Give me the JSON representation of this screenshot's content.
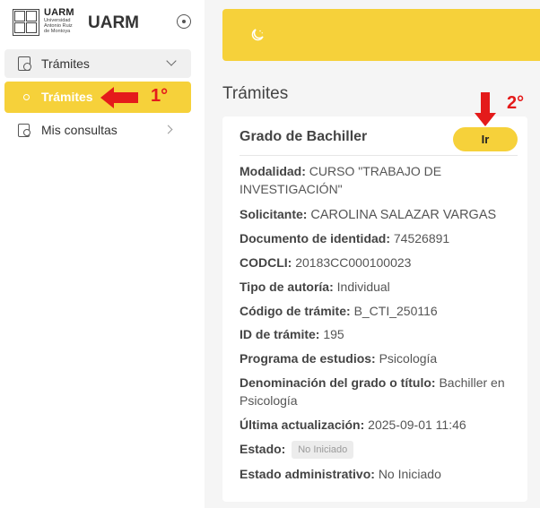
{
  "brand": {
    "short_name": "UARM",
    "institution_line1": "Universidad",
    "institution_line2": "Antonio Ruiz",
    "institution_line3": "de Montoya",
    "title": "UARM"
  },
  "sidebar": {
    "group_label": "Trámites",
    "active_item_label": "Trámites",
    "item2_label": "Mis consultas"
  },
  "annotations": {
    "step1": "1°",
    "step2": "2°",
    "color": "#e41b1b"
  },
  "colors": {
    "accent": "#f6d13a",
    "background": "#f5f5f5"
  },
  "main": {
    "page_title": "Trámites",
    "card": {
      "title": "Grado de Bachiller",
      "button_label": "Ir",
      "fields": {
        "modalidad": {
          "label": "Modalidad:",
          "value": "CURSO \"TRABAJO DE INVESTIGACIÓN\""
        },
        "solicitante": {
          "label": "Solicitante:",
          "value": "CAROLINA SALAZAR VARGAS"
        },
        "documento": {
          "label": "Documento de identidad:",
          "value": "74526891"
        },
        "codcli": {
          "label": "CODCLI:",
          "value": "20183CC000100023"
        },
        "tipo_autoria": {
          "label": "Tipo de autoría:",
          "value": "Individual"
        },
        "codigo_tramite": {
          "label": "Código de trámite:",
          "value": "B_CTI_250116"
        },
        "id_tramite": {
          "label": "ID de trámite:",
          "value": "195"
        },
        "programa": {
          "label": "Programa de estudios:",
          "value": "Psicología"
        },
        "denominacion": {
          "label": "Denominación del grado o título:",
          "value": "Bachiller en Psicología"
        },
        "ultima_actualizacion": {
          "label": "Última actualización:",
          "value": "2025-09-01 11:46"
        },
        "estado": {
          "label": "Estado:",
          "value": "No Iniciado"
        },
        "estado_administrativo": {
          "label": "Estado administrativo:",
          "value": "No Iniciado"
        }
      }
    }
  }
}
